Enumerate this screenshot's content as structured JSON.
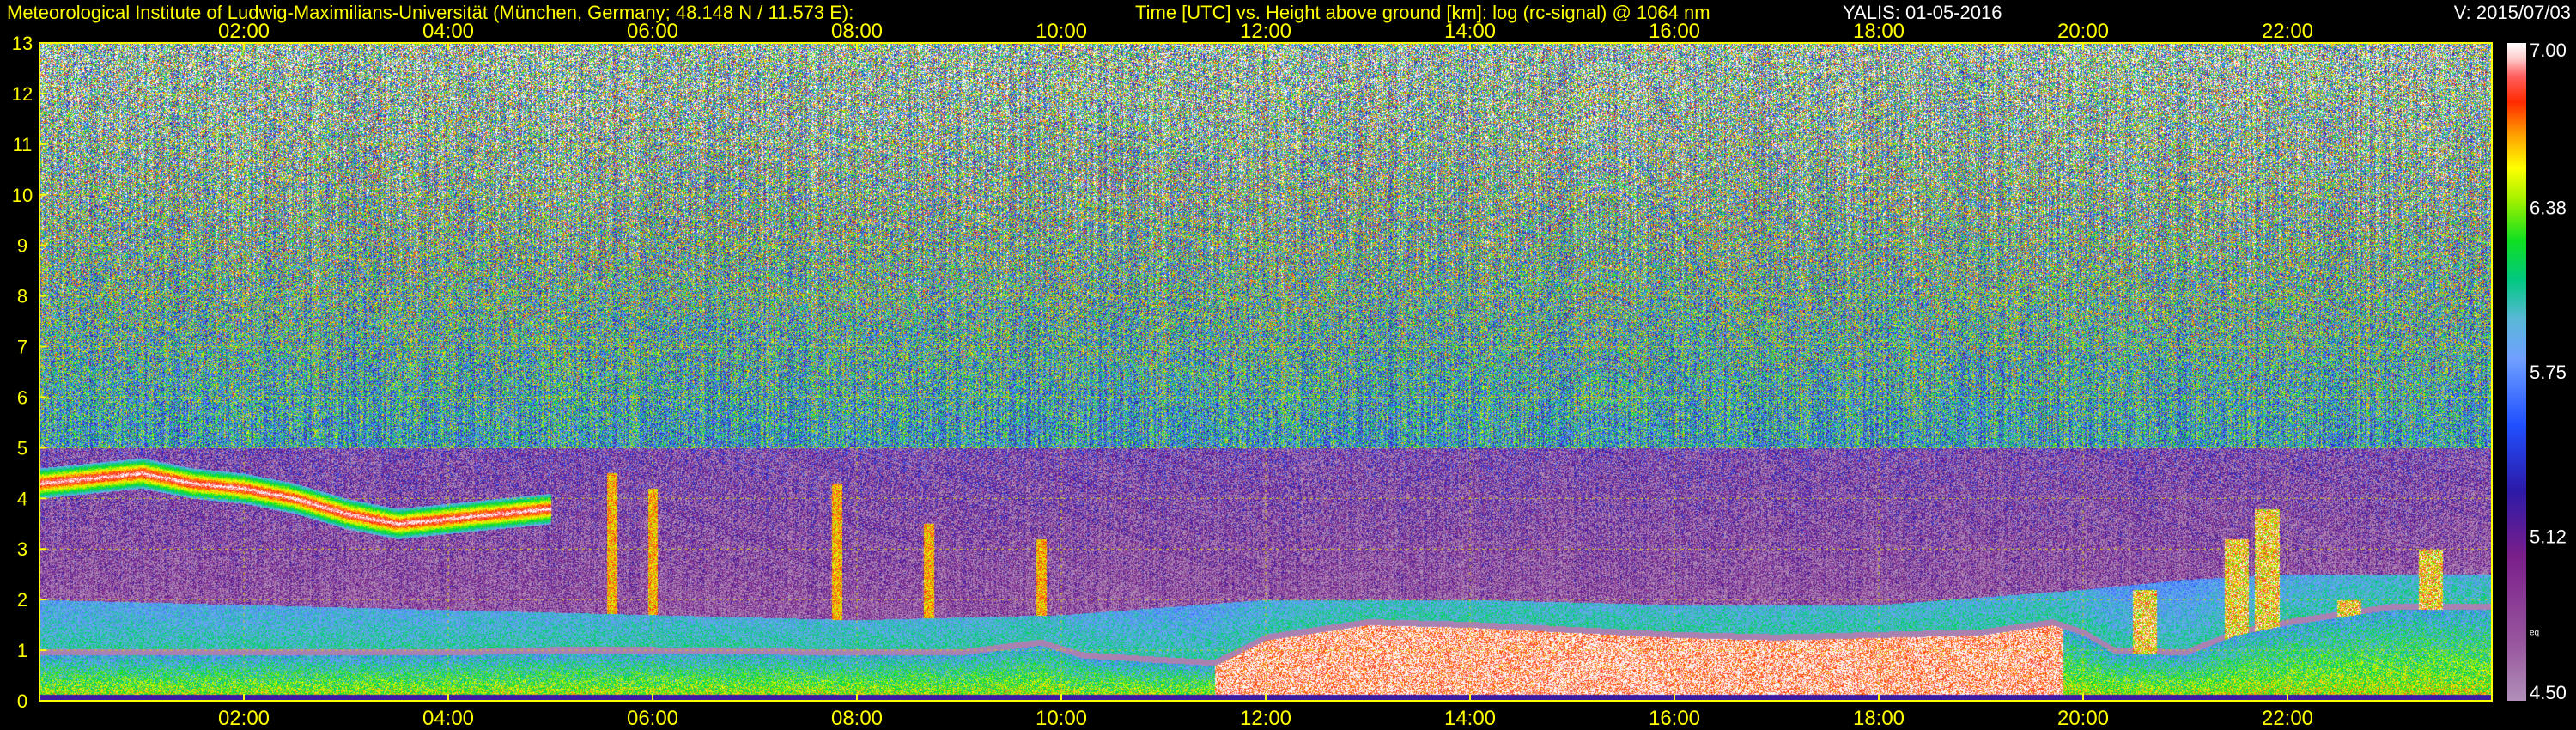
{
  "header": {
    "institute": "Meteorological Institute of Ludwig-Maximilians-Universität (München, Germany; 48.148 N / 11.573 E):",
    "description": "Time [UTC] vs. Height above ground [km]: log (rc-signal) @ 1064 nm",
    "instrument_date": "YALIS: 01-05-2016",
    "version": "V: 2015/07/03"
  },
  "colors": {
    "background": "#000000",
    "text": "#ffff00",
    "grid": "#d8d800"
  },
  "chart_data": {
    "type": "heatmap",
    "x_unit": "hours UTC",
    "xlim": [
      0,
      24
    ],
    "x_ticks": [
      2,
      4,
      6,
      8,
      10,
      12,
      14,
      16,
      18,
      20,
      22
    ],
    "x_tick_labels": [
      "02:00",
      "04:00",
      "06:00",
      "08:00",
      "10:00",
      "12:00",
      "14:00",
      "16:00",
      "18:00",
      "20:00",
      "22:00"
    ],
    "ylim": [
      0,
      13
    ],
    "y_ticks": [
      0,
      1,
      2,
      3,
      4,
      5,
      6,
      7,
      8,
      9,
      10,
      11,
      12,
      13
    ],
    "y_tick_labels": [
      "0",
      "1",
      "2",
      "3",
      "4",
      "5",
      "6",
      "7",
      "8",
      "9",
      "10",
      "11",
      "12",
      "13"
    ],
    "grid": true,
    "colorbar": {
      "range": [
        4.5,
        7.0
      ],
      "tick_labels": [
        "7.00",
        "6.38",
        "5.75",
        "5.12",
        "4.50"
      ],
      "note": "eq",
      "stops": [
        {
          "v": 0.0,
          "c": "#b090b8"
        },
        {
          "v": 0.08,
          "c": "#9a5aa0"
        },
        {
          "v": 0.22,
          "c": "#7a1e8a"
        },
        {
          "v": 0.32,
          "c": "#2c1aa8"
        },
        {
          "v": 0.42,
          "c": "#2050ff"
        },
        {
          "v": 0.52,
          "c": "#70a0ff"
        },
        {
          "v": 0.58,
          "c": "#5ab8d8"
        },
        {
          "v": 0.64,
          "c": "#00c880"
        },
        {
          "v": 0.7,
          "c": "#10e020"
        },
        {
          "v": 0.76,
          "c": "#a0f000"
        },
        {
          "v": 0.81,
          "c": "#ffff00"
        },
        {
          "v": 0.86,
          "c": "#ffa000"
        },
        {
          "v": 0.91,
          "c": "#ff2a00"
        },
        {
          "v": 0.95,
          "c": "#ff6060"
        },
        {
          "v": 0.975,
          "c": "#ffc8c8"
        },
        {
          "v": 1.0,
          "c": "#ffffff"
        }
      ]
    },
    "features": {
      "boundary_layer_top": [
        [
          0,
          0.9
        ],
        [
          2,
          0.9
        ],
        [
          4,
          0.9
        ],
        [
          5,
          0.95
        ],
        [
          6,
          0.95
        ],
        [
          8,
          0.9
        ],
        [
          9,
          0.9
        ],
        [
          9.8,
          1.1
        ],
        [
          10.2,
          0.85
        ],
        [
          11,
          0.75
        ],
        [
          11.5,
          0.7
        ],
        [
          12,
          1.2
        ],
        [
          13,
          1.5
        ],
        [
          14,
          1.45
        ],
        [
          15,
          1.35
        ],
        [
          16,
          1.25
        ],
        [
          17,
          1.2
        ],
        [
          18,
          1.25
        ],
        [
          19,
          1.3
        ],
        [
          19.7,
          1.5
        ],
        [
          20,
          1.3
        ],
        [
          20.3,
          0.95
        ],
        [
          21,
          0.9
        ],
        [
          21.5,
          1.3
        ],
        [
          22,
          1.5
        ],
        [
          23,
          1.8
        ],
        [
          24,
          1.8
        ]
      ],
      "aerosol_upper_layer_top": [
        [
          0,
          2.0
        ],
        [
          2,
          1.9
        ],
        [
          4,
          1.8
        ],
        [
          6,
          1.7
        ],
        [
          8,
          1.6
        ],
        [
          10,
          1.7
        ],
        [
          12,
          2.0
        ],
        [
          14,
          2.0
        ],
        [
          16,
          1.9
        ],
        [
          18,
          1.9
        ],
        [
          20,
          2.2
        ],
        [
          21,
          2.4
        ],
        [
          22,
          2.5
        ],
        [
          24,
          2.5
        ]
      ],
      "cloud_layer": [
        [
          0,
          4.3
        ],
        [
          0.5,
          4.4
        ],
        [
          1,
          4.5
        ],
        [
          1.5,
          4.3
        ],
        [
          2,
          4.2
        ],
        [
          2.5,
          4.0
        ],
        [
          3,
          3.7
        ],
        [
          3.5,
          3.5
        ],
        [
          4,
          3.6
        ],
        [
          4.5,
          3.7
        ],
        [
          5,
          3.8
        ]
      ],
      "cloud_layer_thickness_km": 0.6,
      "virga_streaks": [
        [
          5.6,
          4.5
        ],
        [
          6.0,
          4.2
        ],
        [
          7.8,
          4.3
        ],
        [
          8.7,
          3.5
        ],
        [
          9.8,
          3.2
        ]
      ],
      "upper_cloud_patches": [
        [
          20.6,
          2.2
        ],
        [
          21.5,
          3.2
        ],
        [
          21.8,
          3.8
        ],
        [
          22.6,
          2.0
        ],
        [
          23.4,
          3.0
        ]
      ]
    }
  }
}
